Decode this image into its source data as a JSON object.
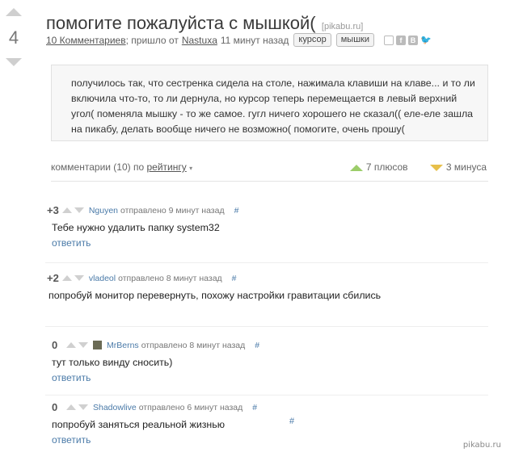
{
  "post": {
    "score": "4",
    "title": "помогите пожалуйста с мышкой(",
    "source": "[pikabu.ru]",
    "comments_link": "10 Комментариев",
    "meta_sep": "; пришло от",
    "author": "Nastuxa",
    "time": "11 минут назад",
    "tags": [
      "курсор",
      "мышки"
    ],
    "share_icons": [
      "save-icon",
      "facebook-icon",
      "vkontakte-icon",
      "twitter-icon"
    ],
    "share_glyphs": [
      "",
      "f",
      "B",
      "🐦"
    ],
    "body": "получилось так, что сестренка сидела на столе, нажимала клавиши на клаве... и то ли включила что-то, то ли дернула, но курсор теперь перемещается в левый верхний угол( поменяла мышку - то же самое. гугл ничего хорошего не сказал(( еле-еле зашла на пикабу, делать вообще ничего не возможно( помогите, очень прошу("
  },
  "comments_header": {
    "count_label": "комментарии (10) по",
    "sort_label": "рейтингу",
    "pluses": "7 плюсов",
    "minuses": "3 минуса"
  },
  "comments": [
    {
      "score": "+3",
      "author": "Nguyen",
      "sent": "отправлено 9 минут назад",
      "hash": "#",
      "text": "Тебе нужно удалить папку system32",
      "reply": "ответить",
      "avatar": false
    },
    {
      "score": "+2",
      "author": "vladeol",
      "sent": "отправлено 8 минут назад",
      "hash": "#",
      "text": "попробуй монитор перевернуть, похожу настройки гравитации сбились",
      "reply": "ответить",
      "avatar": false
    },
    {
      "score": "0",
      "author": "MrBerns",
      "sent": "отправлено 8 минут назад",
      "hash": "#",
      "text": "тут только винду сносить)",
      "reply": "ответить",
      "avatar": true
    },
    {
      "score": "0",
      "author": "Shadowlive",
      "sent": "отправлено 6 минут назад",
      "hash": "#",
      "text": "попробуй заняться реальной жизнью",
      "reply": "ответить",
      "avatar": false
    }
  ],
  "extra_hash": "#",
  "watermark": "pikabu.ru",
  "colors": {
    "link": "#4a7aa8",
    "plus": "#9ccd6a",
    "minus": "#e7c04a",
    "box_bg": "#f7f7f7"
  }
}
